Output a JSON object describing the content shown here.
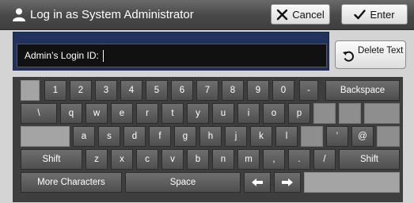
{
  "header": {
    "title": "Log in as System Administrator",
    "cancel_label": "Cancel",
    "enter_label": "Enter"
  },
  "input": {
    "label": "Admin’s Login ID:",
    "value": ""
  },
  "delete_button": {
    "label": "Delete Text"
  },
  "keyboard": {
    "row1": [
      "1",
      "2",
      "3",
      "4",
      "5",
      "6",
      "7",
      "8",
      "9",
      "0",
      "-"
    ],
    "backspace": "Backspace",
    "row2": [
      "\\",
      "q",
      "w",
      "e",
      "r",
      "t",
      "y",
      "u",
      "i",
      "o",
      "p"
    ],
    "row3": [
      "a",
      "s",
      "d",
      "f",
      "g",
      "h",
      "j",
      "k",
      "l",
      "'",
      "@"
    ],
    "shift_left": "Shift",
    "row4": [
      "z",
      "x",
      "c",
      "v",
      "b",
      "n",
      "m",
      ",",
      ".",
      "/"
    ],
    "shift_right": "Shift",
    "more_characters": "More Characters",
    "space": "Space",
    "left_arrow": "←",
    "right_arrow": "→"
  }
}
